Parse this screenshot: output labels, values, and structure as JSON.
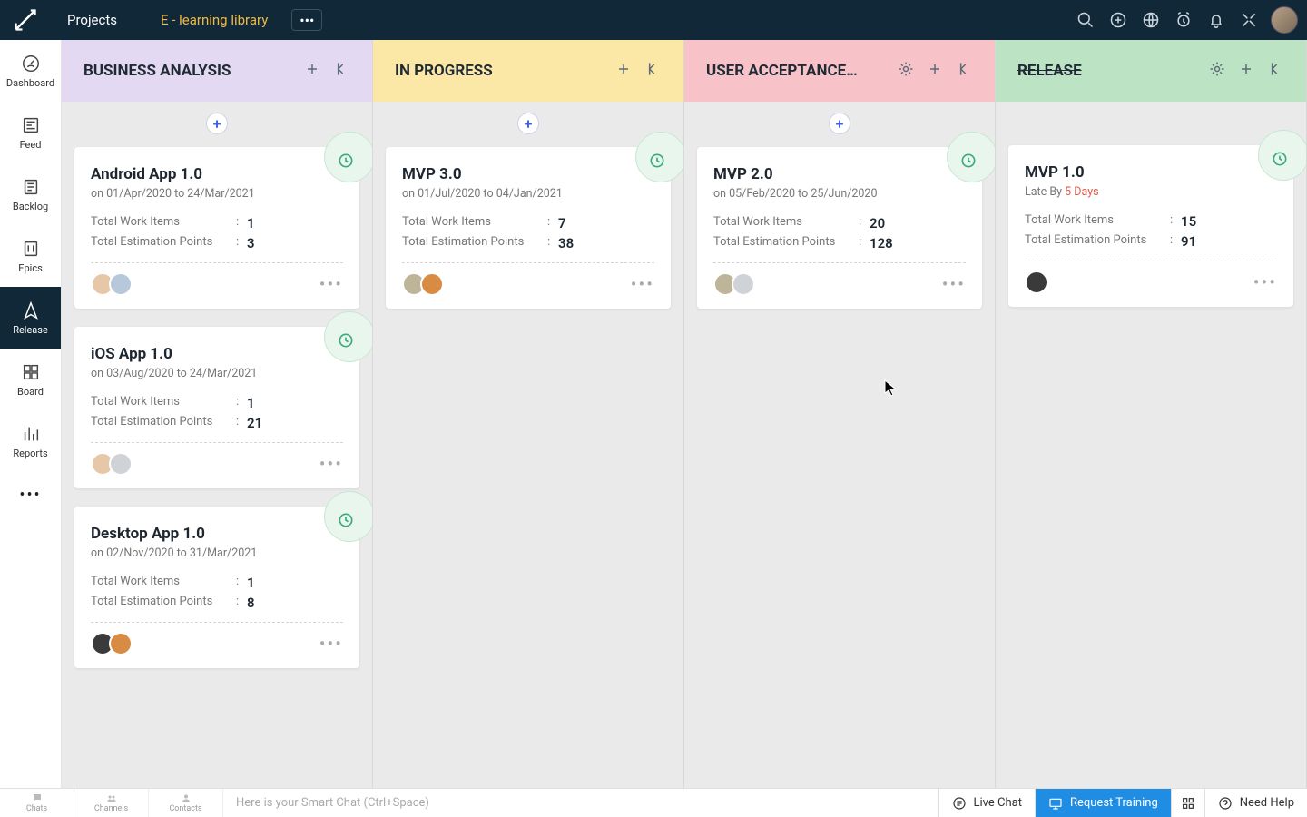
{
  "topbar": {
    "projects_label": "Projects",
    "project_name": "E - learning library"
  },
  "leftnav": {
    "items": [
      {
        "id": "dashboard",
        "label": "Dashboard"
      },
      {
        "id": "feed",
        "label": "Feed"
      },
      {
        "id": "backlog",
        "label": "Backlog"
      },
      {
        "id": "epics",
        "label": "Epics"
      },
      {
        "id": "release",
        "label": "Release"
      },
      {
        "id": "board",
        "label": "Board"
      },
      {
        "id": "reports",
        "label": "Reports"
      }
    ],
    "active": "release"
  },
  "columns": [
    {
      "id": "business-analysis",
      "title": "BUSINESS ANALYSIS",
      "color": "purple",
      "has_gear": false,
      "strike": false,
      "cards": [
        {
          "title": "Android App 1.0",
          "dates": "on 01/Apr/2020 to 24/Mar/2021",
          "late": null,
          "work_items_label": "Total Work Items",
          "work_items": "1",
          "estimation_label": "Total Estimation Points",
          "estimation": "3",
          "avatars": [
            "#e6c7a8",
            "#b6c8d9"
          ]
        },
        {
          "title": "iOS App 1.0",
          "dates": "on 03/Aug/2020 to 24/Mar/2021",
          "late": null,
          "work_items_label": "Total Work Items",
          "work_items": "1",
          "estimation_label": "Total Estimation Points",
          "estimation": "21",
          "avatars": [
            "#e6c7a8",
            "#cfd3d8"
          ]
        },
        {
          "title": "Desktop App 1.0",
          "dates": "on 02/Nov/2020 to 31/Mar/2021",
          "late": null,
          "work_items_label": "Total Work Items",
          "work_items": "1",
          "estimation_label": "Total Estimation Points",
          "estimation": "8",
          "avatars": [
            "#3a3a3a",
            "#d88b42"
          ]
        }
      ]
    },
    {
      "id": "in-progress",
      "title": "IN PROGRESS",
      "color": "yellow",
      "has_gear": false,
      "strike": false,
      "cards": [
        {
          "title": "MVP 3.0",
          "dates": "on 01/Jul/2020 to 04/Jan/2021",
          "late": null,
          "work_items_label": "Total Work Items",
          "work_items": "7",
          "estimation_label": "Total Estimation Points",
          "estimation": "38",
          "avatars": [
            "#beb49a",
            "#d88b42"
          ]
        }
      ]
    },
    {
      "id": "user-acceptance",
      "title": "USER ACCEPTANCE…",
      "color": "pink",
      "has_gear": true,
      "strike": false,
      "cards": [
        {
          "title": "MVP 2.0",
          "dates": "on 05/Feb/2020 to 25/Jun/2020",
          "late": null,
          "work_items_label": "Total Work Items",
          "work_items": "20",
          "estimation_label": "Total Estimation Points",
          "estimation": "128",
          "avatars": [
            "#beb49a",
            "#cfd3d8"
          ]
        }
      ]
    },
    {
      "id": "release",
      "title": "RELEASE",
      "color": "green",
      "has_gear": true,
      "strike": true,
      "cards": [
        {
          "title": "MVP 1.0",
          "dates": "Late By ",
          "late": "5 Days",
          "work_items_label": "Total Work Items",
          "work_items": "15",
          "estimation_label": "Total Estimation Points",
          "estimation": "91",
          "avatars": [
            "#3a3a3a"
          ]
        }
      ]
    }
  ],
  "bottombar": {
    "bnav": [
      {
        "id": "chats",
        "label": "Chats"
      },
      {
        "id": "channels",
        "label": "Channels"
      },
      {
        "id": "contacts",
        "label": "Contacts"
      }
    ],
    "smartchat_placeholder": "Here is your Smart Chat (Ctrl+Space)",
    "live_chat": "Live Chat",
    "request_training": "Request Training",
    "need_help": "Need Help"
  }
}
